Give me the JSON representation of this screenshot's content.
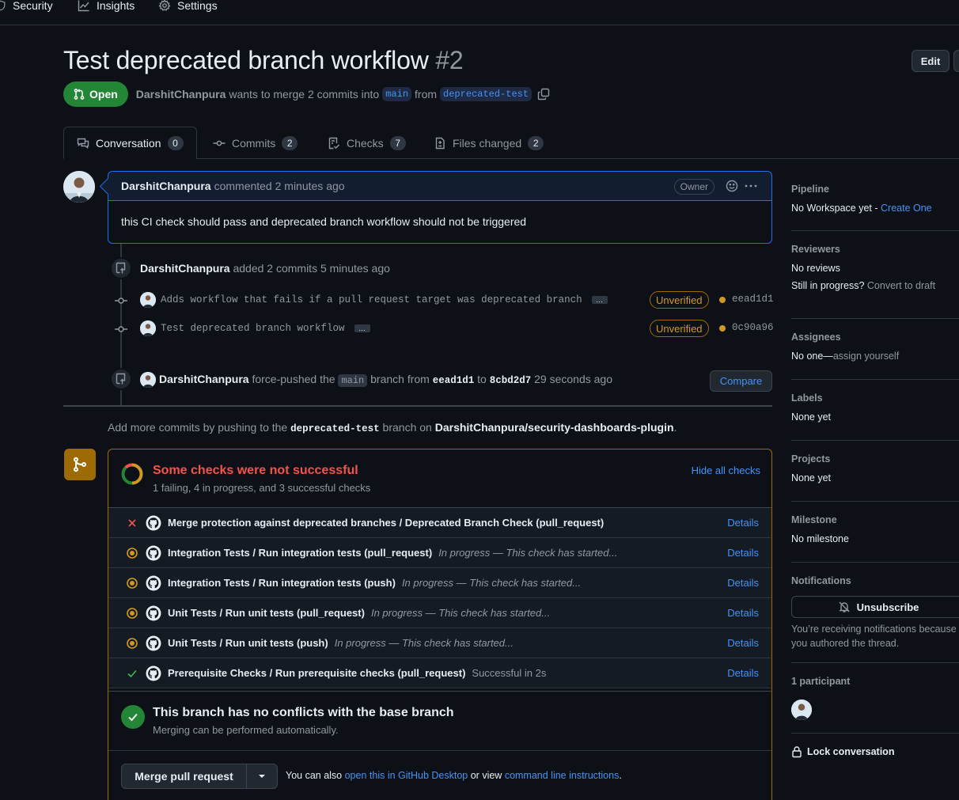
{
  "repo_nav": {
    "security": "Security",
    "insights": "Insights",
    "settings": "Settings"
  },
  "pr": {
    "title": "Test deprecated branch workflow",
    "number": "#2",
    "edit_label": "Edit",
    "state": "Open",
    "author": "DarshitChanpura",
    "merge_text": "wants to merge 2 commits into",
    "base_branch": "main",
    "from_text": "from",
    "head_branch": "deprecated-test"
  },
  "tabs": [
    {
      "label": "Conversation",
      "count": "0"
    },
    {
      "label": "Commits",
      "count": "2"
    },
    {
      "label": "Checks",
      "count": "7"
    },
    {
      "label": "Files changed",
      "count": "2"
    }
  ],
  "comment": {
    "author": "DarshitChanpura",
    "meta": "commented 2 minutes ago",
    "owner_label": "Owner",
    "body": "this CI check should pass and deprecated branch workflow should not be triggered"
  },
  "timeline": {
    "added": {
      "author": "DarshitChanpura",
      "text": "added 2 commits 5 minutes ago"
    },
    "commits": [
      {
        "message": "Adds workflow that fails if a pull request target was deprecated branch",
        "verified": "Unverified",
        "sha": "eead1d1",
        "status_color": "#d29922"
      },
      {
        "message": "Test deprecated branch workflow",
        "verified": "Unverified",
        "sha": "0c90a96",
        "status_color": "#d29922"
      }
    ],
    "force_push": {
      "author": "DarshitChanpura",
      "text1": "force-pushed the",
      "branch": "main",
      "text2": "branch from",
      "from_sha": "eead1d1",
      "text3": "to",
      "to_sha": "8cbd2d7",
      "text4": "29 seconds ago",
      "compare_label": "Compare"
    },
    "add_more": {
      "text1": "Add more commits by pushing to the",
      "branch": "deprecated-test",
      "text2": "branch on",
      "repo": "DarshitChanpura/security-dashboards-plugin",
      "text3": "."
    }
  },
  "checks": {
    "title": "Some checks were not successful",
    "summary": "1 failing, 4 in progress, and 3 successful checks",
    "hide_label": "Hide all checks",
    "items": [
      {
        "status": "failing",
        "name": "Merge protection against deprecated branches / Deprecated Branch Check (pull_request)",
        "desc": "",
        "details": "Details"
      },
      {
        "status": "in_progress",
        "name": "Integration Tests / Run integration tests (pull_request)",
        "desc": "In progress — This check has started...",
        "details": "Details"
      },
      {
        "status": "in_progress",
        "name": "Integration Tests / Run integration tests (push)",
        "desc": "In progress — This check has started...",
        "details": "Details"
      },
      {
        "status": "in_progress",
        "name": "Unit Tests / Run unit tests (pull_request)",
        "desc": "In progress — This check has started...",
        "details": "Details"
      },
      {
        "status": "in_progress",
        "name": "Unit Tests / Run unit tests (push)",
        "desc": "In progress — This check has started...",
        "details": "Details"
      },
      {
        "status": "success",
        "name": "Prerequisite Checks / Run prerequisite checks (pull_request)",
        "desc": "Successful in 2s",
        "details": "Details"
      }
    ],
    "conflicts_title": "This branch has no conflicts with the base branch",
    "conflicts_sub": "Merging can be performed automatically.",
    "merge_button": "Merge pull request",
    "hint_text1": "You can also",
    "hint_link1": "open this in GitHub Desktop",
    "hint_text2": "or view",
    "hint_link2": "command line instructions",
    "hint_text3": "."
  },
  "sidebar": {
    "pipeline": {
      "heading": "Pipeline",
      "text": "No Workspace yet -",
      "link": "Create One"
    },
    "reviewers": {
      "heading": "Reviewers",
      "text": "No reviews",
      "progress_text": "Still in progress?",
      "progress_link": "Convert to draft"
    },
    "assignees": {
      "heading": "Assignees",
      "text": "No one—",
      "link": "assign yourself"
    },
    "labels": {
      "heading": "Labels",
      "text": "None yet"
    },
    "projects": {
      "heading": "Projects",
      "text": "None yet"
    },
    "milestone": {
      "heading": "Milestone",
      "text": "No milestone"
    },
    "notifications": {
      "heading": "Notifications",
      "button": "Unsubscribe",
      "note": "You’re receiving notifications because you authored the thread."
    },
    "participants": {
      "heading": "1 participant"
    },
    "lock": "Lock conversation"
  },
  "colors": {
    "accent": "#4493f8",
    "success": "#238636",
    "danger": "#f85149",
    "attention": "#d29922",
    "open_badge": "#238636"
  }
}
